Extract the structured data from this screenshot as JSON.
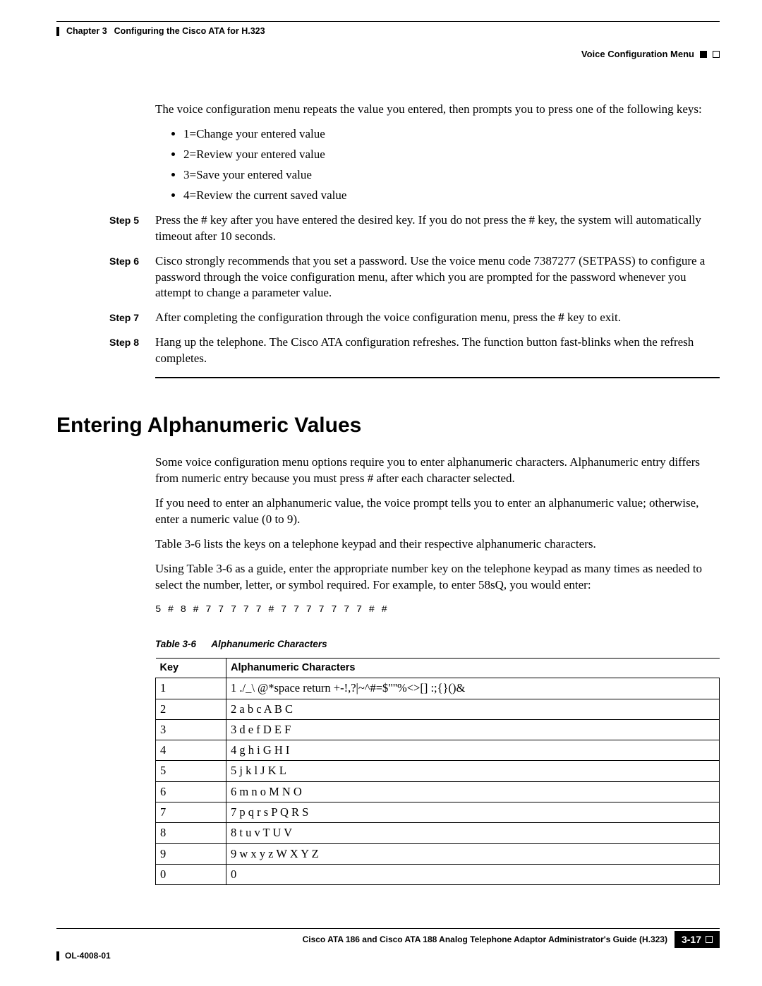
{
  "header": {
    "chapter_label": "Chapter 3",
    "chapter_title": "Configuring the Cisco ATA for H.323",
    "section_title": "Voice Configuration Menu"
  },
  "intro_para": "The voice configuration menu repeats the value you entered, then prompts you to press one of the following keys:",
  "options": [
    "1=Change your entered value",
    "2=Review your entered value",
    "3=Save your entered value",
    "4=Review the current saved value"
  ],
  "steps": [
    {
      "label": "Step 5",
      "text": "Press the # key after you have entered the desired key. If you do not press the # key, the system will automatically timeout after 10 seconds."
    },
    {
      "label": "Step 6",
      "text": "Cisco strongly recommends that you set a password. Use the voice menu code 7387277 (SETPASS) to configure a password through the voice configuration menu, after which you are prompted for the password whenever you attempt to change a parameter value."
    },
    {
      "label": "Step 7",
      "text_pre": "After completing the configuration through the voice configuration menu, press the ",
      "bold": "#",
      "text_post": " key to exit."
    },
    {
      "label": "Step 8",
      "text": "Hang up the telephone. The Cisco ATA configuration refreshes. The function button fast-blinks when the refresh completes."
    }
  ],
  "heading": "Entering Alphanumeric Values",
  "body_paras": [
    "Some voice configuration menu options require you to enter alphanumeric characters. Alphanumeric entry differs from numeric entry because you must press # after each character selected.",
    "If you need to enter an alphanumeric value, the voice prompt tells you to enter an alphanumeric value; otherwise, enter a numeric value (0 to 9).",
    "Table 3-6 lists the keys on a telephone keypad and their respective alphanumeric characters.",
    "Using Table 3-6 as a guide, enter the appropriate number key on the telephone keypad as many times as needed to select the number, letter, or symbol required. For example, to enter 58sQ, you would enter:"
  ],
  "code_line": "5 # 8 # 7 7 7 7 7 # 7 7 7 7 7 7 7 # #",
  "table": {
    "caption_num": "Table 3-6",
    "caption_title": "Alphanumeric Characters",
    "headers": [
      "Key",
      "Alphanumeric Characters"
    ],
    "rows": [
      [
        "1",
        "1 ./_\\ @*space return +-!,?|~^#=$\"''%<>[] :;{}()&"
      ],
      [
        "2",
        "2 a b c A B C"
      ],
      [
        "3",
        "3 d e f D E F"
      ],
      [
        "4",
        "4 g h i G H I"
      ],
      [
        "5",
        "5 j k l J K L"
      ],
      [
        "6",
        "6 m n o M N O"
      ],
      [
        "7",
        "7 p q r s P Q R S"
      ],
      [
        "8",
        "8 t u v T U V"
      ],
      [
        "9",
        "9 w x y z W X Y Z"
      ],
      [
        "0",
        "0"
      ]
    ]
  },
  "footer": {
    "doc_title": "Cisco ATA 186 and Cisco ATA 188 Analog Telephone Adaptor Administrator's Guide (H.323)",
    "ol": "OL-4008-01",
    "page": "3-17"
  }
}
